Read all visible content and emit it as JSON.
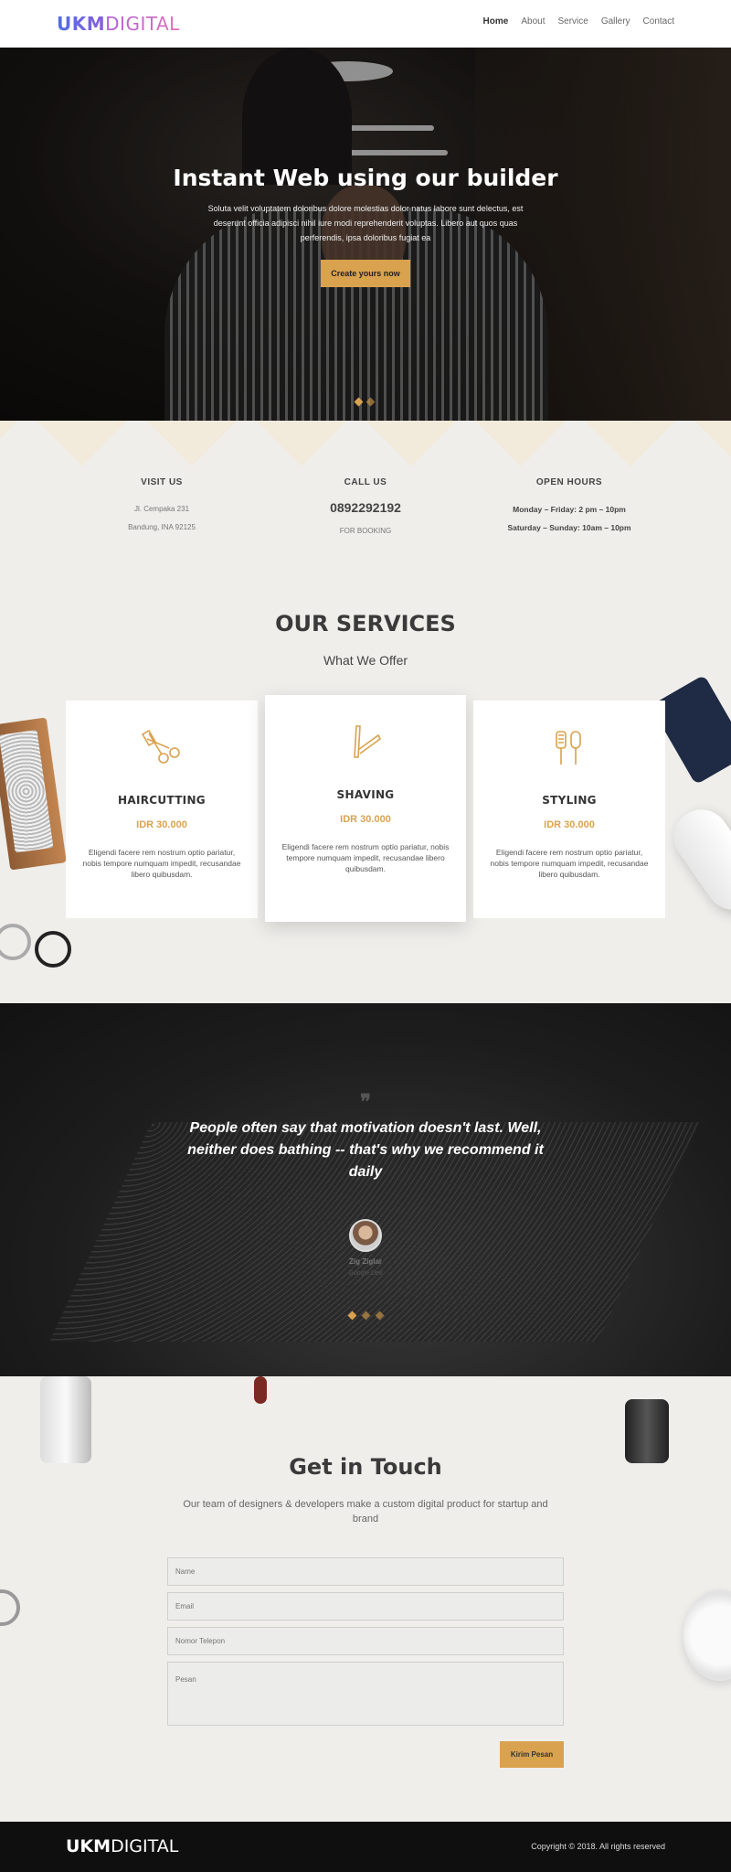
{
  "brand": {
    "logo_bold": "UKM",
    "logo_light": "DIGITAL"
  },
  "nav": {
    "items": [
      "Home",
      "About",
      "Service",
      "Gallery",
      "Contact"
    ],
    "active": "Home"
  },
  "hero": {
    "title": "Instant Web using our builder",
    "text": "Soluta velit voluptatem doloribus dolore molestias dolor natus labore sunt delectus, est deserunt officia adipisci nihil iure modi reprehenderit voluptas. Libero aut quos quas perferendis, ipsa doloribus fugiat ea",
    "cta": "Create yours now",
    "slider_dots": 2,
    "active_slide": 1
  },
  "info": {
    "visit": {
      "title": "VISIT US",
      "line1": "Jl. Cempaka 231",
      "line2": "Bandung, INA 92125"
    },
    "call": {
      "title": "CALL US",
      "phone": "0892292192",
      "note": "FOR BOOKING"
    },
    "hours": {
      "title": "OPEN HOURS",
      "line1": "Monday – Friday: 2 pm – 10pm",
      "line2": "Saturday – Sunday: 10am – 10pm"
    }
  },
  "services": {
    "title": "OUR SERVICES",
    "subtitle": "What We Offer",
    "items": [
      {
        "name": "HAIRCUTTING",
        "price": "IDR 30.000",
        "icon": "scissors-comb-icon",
        "desc": "Eligendi facere rem nostrum optio pariatur, nobis tempore numquam impedit, recusandae libero quibusdam."
      },
      {
        "name": "SHAVING",
        "price": "IDR 30.000",
        "icon": "razor-icon",
        "desc": "Eligendi facere rem nostrum optio pariatur, nobis tempore numquam impedit, recusandae libero quibusdam."
      },
      {
        "name": "STYLING",
        "price": "IDR 30.000",
        "icon": "brush-comb-icon",
        "desc": "Eligendi facere rem nostrum optio pariatur, nobis tempore numquam impedit, recusandae libero quibusdam."
      }
    ]
  },
  "testimonial": {
    "quote_icon": "quote-icon",
    "quote": "People often say that motivation doesn't last. Well, neither does bathing -- that's why we recommend it daily",
    "name": "Zig Ziglar",
    "role": "Google Dev",
    "slider_dots": 3
  },
  "contact": {
    "title": "Get in Touch",
    "subtitle": "Our team of designers & developers make a custom digital product for startup and brand",
    "name_placeholder": "Name",
    "email_placeholder": "Email",
    "phone_placeholder": "Nomor Telepon",
    "message_placeholder": "Pesan",
    "submit": "Kirim Pesan"
  },
  "footer": {
    "logo_bold": "UKM",
    "logo_light": "DIGITAL",
    "copyright": "Copyright © 2018. All rights reserved"
  },
  "colors": {
    "accent": "#d9a24f",
    "dark": "#0f0f0f",
    "background": "#efeeeb"
  }
}
